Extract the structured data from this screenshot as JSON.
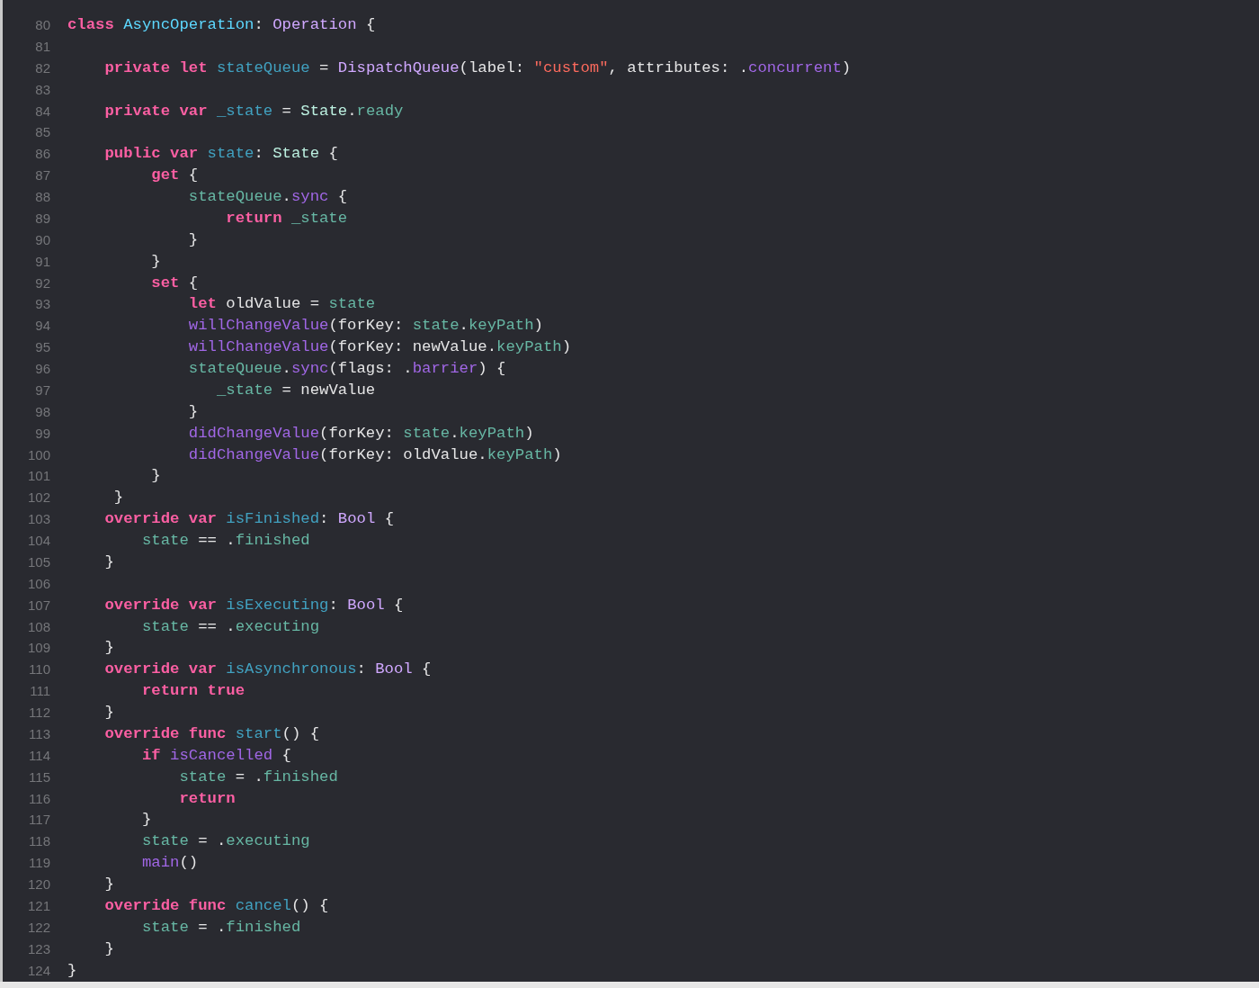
{
  "editor": {
    "lines": [
      {
        "number": "80",
        "tokens": [
          {
            "text": "class ",
            "kind": "keyword"
          },
          {
            "text": "AsyncOperation",
            "kind": "class_decl"
          },
          {
            "text": ": ",
            "kind": "plain"
          },
          {
            "text": "Operation",
            "kind": "type"
          },
          {
            "text": " {",
            "kind": "plain"
          }
        ]
      },
      {
        "number": "81"
      },
      {
        "number": "82",
        "tokens": [
          {
            "text": "    private let ",
            "kind": "keyword"
          },
          {
            "text": "stateQueue",
            "kind": "decl"
          },
          {
            "text": " = ",
            "kind": "plain"
          },
          {
            "text": "DispatchQueue",
            "kind": "type"
          },
          {
            "text": "(label: ",
            "kind": "plain"
          },
          {
            "text": "\"custom\"",
            "kind": "string"
          },
          {
            "text": ", attributes: .",
            "kind": "plain"
          },
          {
            "text": "concurrent",
            "kind": "system"
          },
          {
            "text": ")",
            "kind": "plain"
          }
        ]
      },
      {
        "number": "83"
      },
      {
        "number": "84",
        "tokens": [
          {
            "text": "    private var ",
            "kind": "keyword"
          },
          {
            "text": "_state",
            "kind": "decl"
          },
          {
            "text": " = ",
            "kind": "plain"
          },
          {
            "text": "State",
            "kind": "project_type"
          },
          {
            "text": ".",
            "kind": "plain"
          },
          {
            "text": "ready",
            "kind": "member"
          }
        ]
      },
      {
        "number": "85"
      },
      {
        "number": "86",
        "tokens": [
          {
            "text": "    public var ",
            "kind": "keyword"
          },
          {
            "text": "state",
            "kind": "decl"
          },
          {
            "text": ": ",
            "kind": "plain"
          },
          {
            "text": "State",
            "kind": "project_type"
          },
          {
            "text": " {",
            "kind": "plain"
          }
        ]
      },
      {
        "number": "87",
        "tokens": [
          {
            "text": "         get",
            "kind": "keyword"
          },
          {
            "text": " {",
            "kind": "plain"
          }
        ]
      },
      {
        "number": "88",
        "tokens": [
          {
            "text": "             stateQueue",
            "kind": "member"
          },
          {
            "text": ".",
            "kind": "plain"
          },
          {
            "text": "sync",
            "kind": "system"
          },
          {
            "text": " {",
            "kind": "plain"
          }
        ]
      },
      {
        "number": "89",
        "tokens": [
          {
            "text": "                 return ",
            "kind": "keyword"
          },
          {
            "text": "_state",
            "kind": "member"
          }
        ]
      },
      {
        "number": "90",
        "tokens": [
          {
            "text": "             }",
            "kind": "plain"
          }
        ]
      },
      {
        "number": "91",
        "tokens": [
          {
            "text": "         }",
            "kind": "plain"
          }
        ]
      },
      {
        "number": "92",
        "tokens": [
          {
            "text": "         set",
            "kind": "keyword"
          },
          {
            "text": " {",
            "kind": "plain"
          }
        ]
      },
      {
        "number": "93",
        "tokens": [
          {
            "text": "             let",
            "kind": "keyword"
          },
          {
            "text": " oldValue = ",
            "kind": "plain"
          },
          {
            "text": "state",
            "kind": "member"
          }
        ]
      },
      {
        "number": "94",
        "tokens": [
          {
            "text": "             willChangeValue",
            "kind": "system"
          },
          {
            "text": "(forKey: ",
            "kind": "plain"
          },
          {
            "text": "state",
            "kind": "member"
          },
          {
            "text": ".",
            "kind": "plain"
          },
          {
            "text": "keyPath",
            "kind": "member"
          },
          {
            "text": ")",
            "kind": "plain"
          }
        ]
      },
      {
        "number": "95",
        "tokens": [
          {
            "text": "             willChangeValue",
            "kind": "system"
          },
          {
            "text": "(forKey: newValue.",
            "kind": "plain"
          },
          {
            "text": "keyPath",
            "kind": "member"
          },
          {
            "text": ")",
            "kind": "plain"
          }
        ]
      },
      {
        "number": "96",
        "tokens": [
          {
            "text": "             stateQueue",
            "kind": "member"
          },
          {
            "text": ".",
            "kind": "plain"
          },
          {
            "text": "sync",
            "kind": "system"
          },
          {
            "text": "(flags: .",
            "kind": "plain"
          },
          {
            "text": "barrier",
            "kind": "system"
          },
          {
            "text": ") {",
            "kind": "plain"
          }
        ]
      },
      {
        "number": "97",
        "tokens": [
          {
            "text": "                _state",
            "kind": "member"
          },
          {
            "text": " = newValue",
            "kind": "plain"
          }
        ]
      },
      {
        "number": "98",
        "tokens": [
          {
            "text": "             }",
            "kind": "plain"
          }
        ]
      },
      {
        "number": "99",
        "tokens": [
          {
            "text": "             didChangeValue",
            "kind": "system"
          },
          {
            "text": "(forKey: ",
            "kind": "plain"
          },
          {
            "text": "state",
            "kind": "member"
          },
          {
            "text": ".",
            "kind": "plain"
          },
          {
            "text": "keyPath",
            "kind": "member"
          },
          {
            "text": ")",
            "kind": "plain"
          }
        ]
      },
      {
        "number": "100",
        "tokens": [
          {
            "text": "             didChangeValue",
            "kind": "system"
          },
          {
            "text": "(forKey: oldValue.",
            "kind": "plain"
          },
          {
            "text": "keyPath",
            "kind": "member"
          },
          {
            "text": ")",
            "kind": "plain"
          }
        ]
      },
      {
        "number": "101",
        "tokens": [
          {
            "text": "         }",
            "kind": "plain"
          }
        ]
      },
      {
        "number": "102",
        "tokens": [
          {
            "text": "     }",
            "kind": "plain"
          }
        ]
      },
      {
        "number": "103",
        "tokens": [
          {
            "text": "    override var ",
            "kind": "keyword"
          },
          {
            "text": "isFinished",
            "kind": "decl"
          },
          {
            "text": ": ",
            "kind": "plain"
          },
          {
            "text": "Bool",
            "kind": "type"
          },
          {
            "text": " {",
            "kind": "plain"
          }
        ]
      },
      {
        "number": "104",
        "tokens": [
          {
            "text": "        state",
            "kind": "member"
          },
          {
            "text": " == .",
            "kind": "plain"
          },
          {
            "text": "finished",
            "kind": "member"
          }
        ]
      },
      {
        "number": "105",
        "tokens": [
          {
            "text": "    }",
            "kind": "plain"
          }
        ]
      },
      {
        "number": "106"
      },
      {
        "number": "107",
        "tokens": [
          {
            "text": "    override var ",
            "kind": "keyword"
          },
          {
            "text": "isExecuting",
            "kind": "decl"
          },
          {
            "text": ": ",
            "kind": "plain"
          },
          {
            "text": "Bool",
            "kind": "type"
          },
          {
            "text": " {",
            "kind": "plain"
          }
        ]
      },
      {
        "number": "108",
        "tokens": [
          {
            "text": "        state",
            "kind": "member"
          },
          {
            "text": " == .",
            "kind": "plain"
          },
          {
            "text": "executing",
            "kind": "member"
          }
        ]
      },
      {
        "number": "109",
        "tokens": [
          {
            "text": "    }",
            "kind": "plain"
          }
        ]
      },
      {
        "number": "110",
        "tokens": [
          {
            "text": "    override var ",
            "kind": "keyword"
          },
          {
            "text": "isAsynchronous",
            "kind": "decl"
          },
          {
            "text": ": ",
            "kind": "plain"
          },
          {
            "text": "Bool",
            "kind": "type"
          },
          {
            "text": " {",
            "kind": "plain"
          }
        ]
      },
      {
        "number": "111",
        "tokens": [
          {
            "text": "        return true",
            "kind": "keyword"
          }
        ]
      },
      {
        "number": "112",
        "tokens": [
          {
            "text": "    }",
            "kind": "plain"
          }
        ]
      },
      {
        "number": "113",
        "tokens": [
          {
            "text": "    override func ",
            "kind": "keyword"
          },
          {
            "text": "start",
            "kind": "decl"
          },
          {
            "text": "() {",
            "kind": "plain"
          }
        ]
      },
      {
        "number": "114",
        "tokens": [
          {
            "text": "        if ",
            "kind": "keyword"
          },
          {
            "text": "isCancelled",
            "kind": "system"
          },
          {
            "text": " {",
            "kind": "plain"
          }
        ]
      },
      {
        "number": "115",
        "tokens": [
          {
            "text": "            state",
            "kind": "member"
          },
          {
            "text": " = .",
            "kind": "plain"
          },
          {
            "text": "finished",
            "kind": "member"
          }
        ]
      },
      {
        "number": "116",
        "tokens": [
          {
            "text": "            return",
            "kind": "keyword"
          }
        ]
      },
      {
        "number": "117",
        "tokens": [
          {
            "text": "        }",
            "kind": "plain"
          }
        ]
      },
      {
        "number": "118",
        "tokens": [
          {
            "text": "        state",
            "kind": "member"
          },
          {
            "text": " = .",
            "kind": "plain"
          },
          {
            "text": "executing",
            "kind": "member"
          }
        ]
      },
      {
        "number": "119",
        "tokens": [
          {
            "text": "        main",
            "kind": "system"
          },
          {
            "text": "()",
            "kind": "plain"
          }
        ]
      },
      {
        "number": "120",
        "tokens": [
          {
            "text": "    }",
            "kind": "plain"
          }
        ]
      },
      {
        "number": "121",
        "tokens": [
          {
            "text": "    override func ",
            "kind": "keyword"
          },
          {
            "text": "cancel",
            "kind": "decl"
          },
          {
            "text": "() {",
            "kind": "plain"
          }
        ]
      },
      {
        "number": "122",
        "tokens": [
          {
            "text": "        state",
            "kind": "member"
          },
          {
            "text": " = .",
            "kind": "plain"
          },
          {
            "text": "finished",
            "kind": "member"
          }
        ]
      },
      {
        "number": "123",
        "tokens": [
          {
            "text": "    }",
            "kind": "plain"
          }
        ]
      },
      {
        "number": "124",
        "tokens": [
          {
            "text": "}",
            "kind": "plain"
          }
        ]
      }
    ]
  }
}
